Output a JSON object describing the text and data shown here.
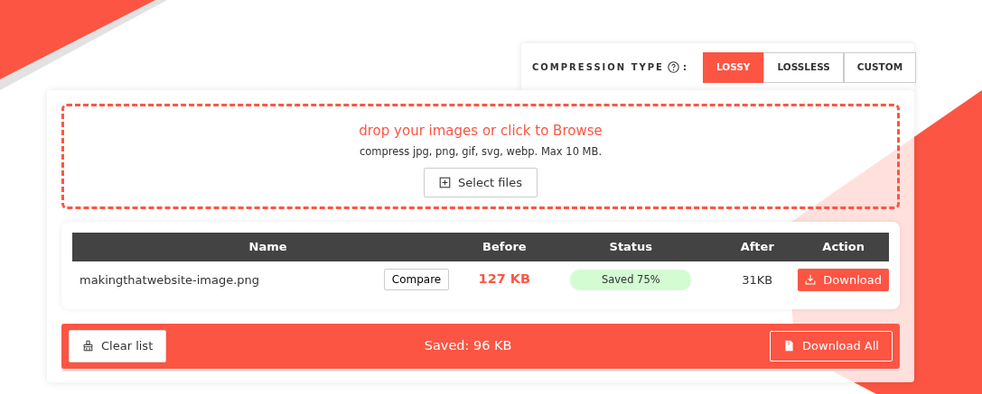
{
  "compression": {
    "label": "COMPRESSION TYPE",
    "colon": ":",
    "options": [
      {
        "label": "LOSSY",
        "selected": true
      },
      {
        "label": "LOSSLESS",
        "selected": false
      },
      {
        "label": "CUSTOM",
        "selected": false
      }
    ]
  },
  "dropzone": {
    "title": "drop your images or click to Browse",
    "subtitle": "compress jpg, png, gif, svg, webp. Max 10 MB.",
    "button": "Select files"
  },
  "table": {
    "columns": [
      "Name",
      "Before",
      "Status",
      "After",
      "Action"
    ],
    "rows": [
      {
        "name": "makingthatwebsite-image.png",
        "compare": "Compare",
        "before": "127 KB",
        "status": "Saved 75%",
        "after": "31KB",
        "action": "Download"
      }
    ]
  },
  "footer": {
    "clear_button": "Clear list",
    "summary": "Saved: 96 KB",
    "download_all_button": "Download All"
  }
}
